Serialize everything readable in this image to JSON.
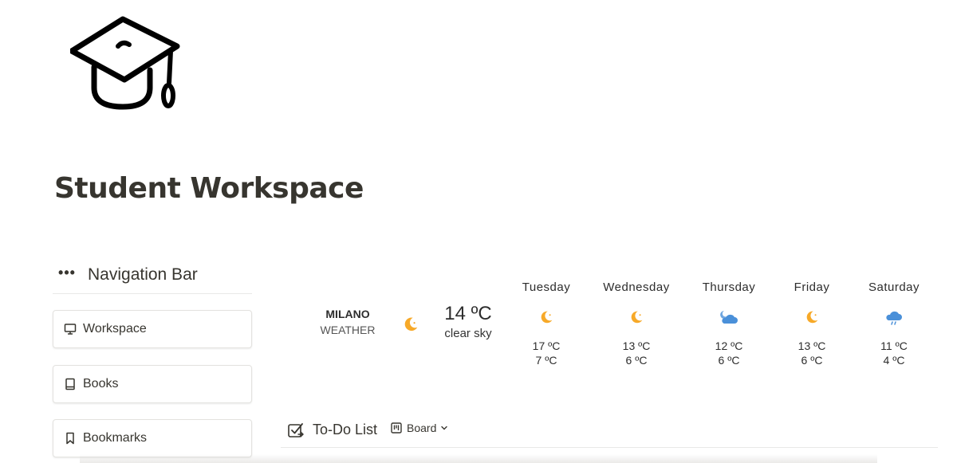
{
  "page": {
    "title": "Student Workspace",
    "icon": "graduation-cap-icon"
  },
  "navigation": {
    "header": "Navigation Bar",
    "menu_icon": "more-dots-icon",
    "items": [
      {
        "label": "Workspace",
        "icon": "monitor-icon"
      },
      {
        "label": "Books",
        "icon": "book-icon"
      },
      {
        "label": "Bookmarks",
        "icon": "bookmark-icon"
      }
    ]
  },
  "weather": {
    "city": "MILANO",
    "subtitle": "WEATHER",
    "current": {
      "temp": "14 ºC",
      "condition": "clear sky",
      "icon": "moon-icon"
    },
    "forecast": [
      {
        "day": "Tuesday",
        "icon": "moon-icon",
        "high": "17 ºC",
        "low": "7 ºC"
      },
      {
        "day": "Wednesday",
        "icon": "moon-icon",
        "high": "13 ºC",
        "low": "6 ºC"
      },
      {
        "day": "Thursday",
        "icon": "cloud-moon-icon",
        "high": "12 ºC",
        "low": "6 ºC"
      },
      {
        "day": "Friday",
        "icon": "moon-icon",
        "high": "13 ºC",
        "low": "6 ºC"
      },
      {
        "day": "Saturday",
        "icon": "rain-cloud-icon",
        "high": "11 ºC",
        "low": "4 ºC"
      }
    ],
    "colors": {
      "moon": "#f7a928",
      "cloud": "#4a90d9"
    }
  },
  "todo": {
    "title": "To-Do List",
    "view_label": "Board",
    "icon": "checklist-icon"
  }
}
